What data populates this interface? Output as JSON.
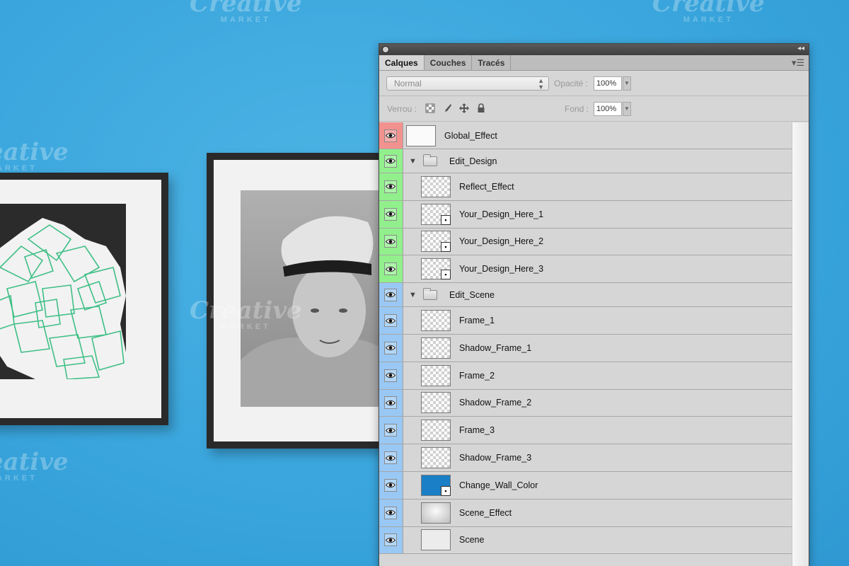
{
  "watermark": {
    "brand": "Creative",
    "sub": "MARKET"
  },
  "panel": {
    "tabs": [
      {
        "label": "Calques",
        "active": true
      },
      {
        "label": "Couches",
        "active": false
      },
      {
        "label": "Tracés",
        "active": false
      }
    ],
    "blend_mode": "Normal",
    "opacity_label": "Opacité :",
    "opacity_value": "100%",
    "lock_label": "Verrou :",
    "fill_label": "Fond :",
    "fill_value": "100%",
    "lock_icons": [
      "lock-transparent-pixels-icon",
      "lock-image-pixels-icon",
      "lock-position-icon",
      "lock-all-icon"
    ],
    "colors": {
      "red": "#f2928f",
      "green": "#91f08c",
      "blue": "#99c8f4"
    },
    "layers": [
      {
        "name": "Global_Effect",
        "color": "red",
        "kind": "plain",
        "indent": false
      },
      {
        "name": "Edit_Design",
        "color": "green",
        "kind": "group",
        "indent": false
      },
      {
        "name": "Reflect_Effect",
        "color": "green",
        "kind": "transparent",
        "indent": true
      },
      {
        "name": "Your_Design_Here_1",
        "color": "green",
        "kind": "smart",
        "indent": true
      },
      {
        "name": "Your_Design_Here_2",
        "color": "green",
        "kind": "smart",
        "indent": true
      },
      {
        "name": "Your_Design_Here_3",
        "color": "green",
        "kind": "smart",
        "indent": true
      },
      {
        "name": "Edit_Scene",
        "color": "blue",
        "kind": "group",
        "indent": false
      },
      {
        "name": "Frame_1",
        "color": "blue",
        "kind": "transparent",
        "indent": true
      },
      {
        "name": "Shadow_Frame_1",
        "color": "blue",
        "kind": "transparent",
        "indent": true
      },
      {
        "name": "Frame_2",
        "color": "blue",
        "kind": "transparent",
        "indent": true
      },
      {
        "name": "Shadow_Frame_2",
        "color": "blue",
        "kind": "transparent",
        "indent": true
      },
      {
        "name": "Frame_3",
        "color": "blue",
        "kind": "transparent",
        "indent": true
      },
      {
        "name": "Shadow_Frame_3",
        "color": "blue",
        "kind": "transparent",
        "indent": true
      },
      {
        "name": "Change_Wall_Color",
        "color": "blue",
        "kind": "blue-smart",
        "indent": true
      },
      {
        "name": "Scene_Effect",
        "color": "blue",
        "kind": "gradient",
        "indent": true
      },
      {
        "name": "Scene",
        "color": "blue",
        "kind": "light",
        "indent": true
      }
    ]
  }
}
